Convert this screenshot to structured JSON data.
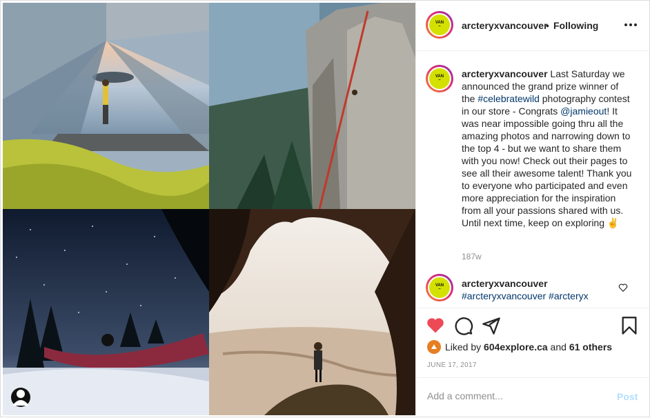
{
  "header": {
    "username": "arcteryxvancouver",
    "separator": "•",
    "follow_status": "Following",
    "avatar_text": [
      "VAN",
      "~"
    ]
  },
  "caption": {
    "username": "arcteryxvancouver",
    "text_1": " Last Saturday we announced the grand prize winner of the ",
    "hashtag": "#celebratewild",
    "text_2": " photography contest in our store - Congrats ",
    "mention": "@jamieout",
    "text_3": "! It was near impossible going thru all the amazing photos and narrowing down to the top 4 - but we want to share them with you now! Check out their pages to see all their awesome talent! Thank you to everyone who participated and even more appreciation for the inspiration from all your passions shared with us. Until next time, keep on exploring ",
    "emoji": "✌",
    "time": "187w"
  },
  "reply": {
    "username": "arcteryxvancouver",
    "tags": "#arcteryxvancouver #arcteryx"
  },
  "likes": {
    "prefix": "Liked by ",
    "user": "604explore.ca",
    "middle": " and ",
    "others": "61 others"
  },
  "date": "JUNE 17, 2017",
  "comment_box": {
    "placeholder": "Add a comment...",
    "post_label": "Post"
  },
  "colors": {
    "like": "#ed4956",
    "link": "#00376b",
    "post_disabled": "#b2dffc"
  },
  "icons": [
    "heart-icon",
    "comment-icon",
    "share-icon",
    "bookmark-icon",
    "more-icon",
    "user-tag-icon"
  ]
}
